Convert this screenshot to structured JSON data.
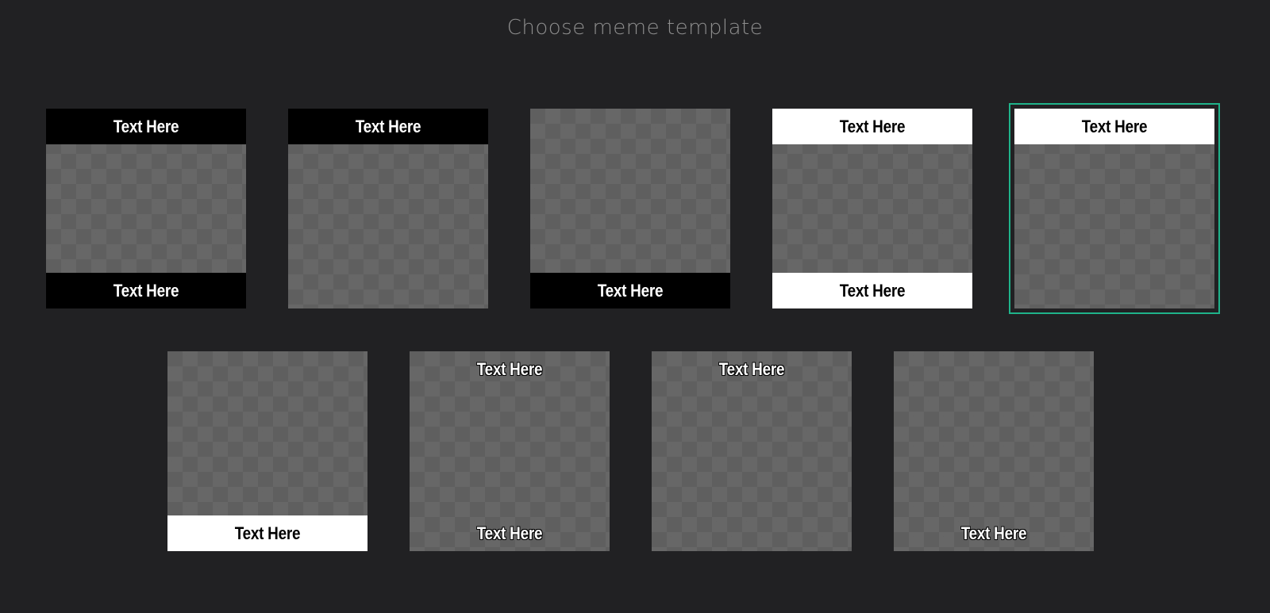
{
  "header": {
    "title": "Choose meme template"
  },
  "colors": {
    "background": "#212123",
    "title": "#8e8e8e",
    "selected_outline": "#1fb38a",
    "checker_light": "#676767",
    "checker_dark": "#5f5f5f"
  },
  "templates": [
    {
      "name": "black-top-bottom",
      "top_text": "Text Here",
      "bottom_text": "Text Here",
      "selected": false
    },
    {
      "name": "black-top",
      "top_text": "Text Here",
      "selected": false
    },
    {
      "name": "black-bottom",
      "bottom_text": "Text Here",
      "selected": false
    },
    {
      "name": "white-top-bottom",
      "top_text": "Text Here",
      "bottom_text": "Text Here",
      "selected": false
    },
    {
      "name": "white-top",
      "top_text": "Text Here",
      "selected": true
    },
    {
      "name": "white-bottom",
      "bottom_text": "Text Here",
      "selected": false
    },
    {
      "name": "outline-top-bottom",
      "top_text": "Text Here",
      "bottom_text": "Text Here",
      "selected": false
    },
    {
      "name": "outline-top",
      "top_text": "Text Here",
      "selected": false
    },
    {
      "name": "outline-bottom",
      "bottom_text": "Text Here",
      "selected": false
    }
  ]
}
